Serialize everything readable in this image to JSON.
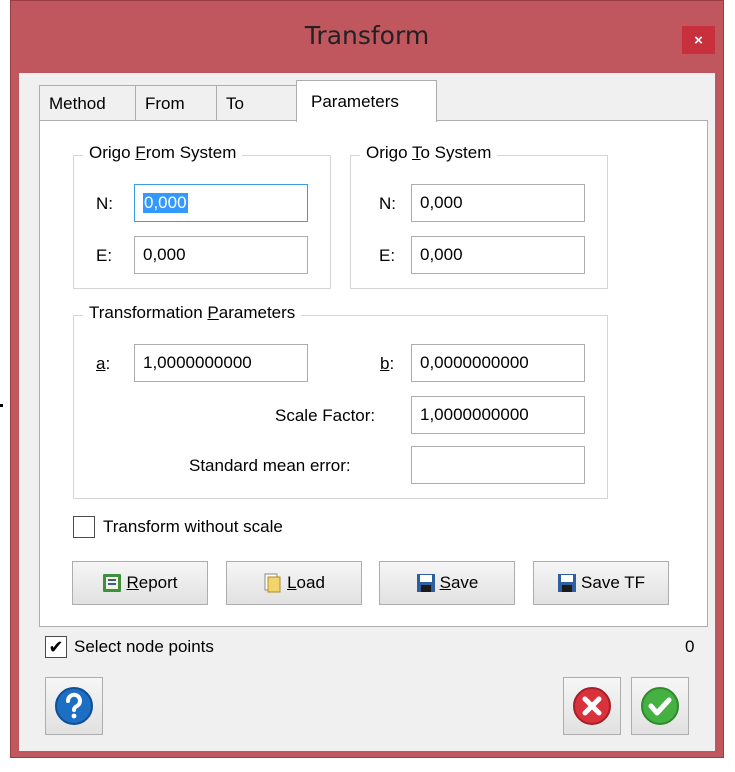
{
  "window": {
    "title": "Transform",
    "close_glyph": "×"
  },
  "tabs": [
    {
      "label": "Method",
      "active": false
    },
    {
      "label": "From",
      "active": false
    },
    {
      "label": "To",
      "active": false
    },
    {
      "label": "Parameters",
      "active": true
    }
  ],
  "origo_from": {
    "legend_pre": "Origo ",
    "legend_key": "F",
    "legend_post": "rom System",
    "n_label": "N:",
    "n_value": "0,000",
    "e_label": "E:",
    "e_value": "0,000"
  },
  "origo_to": {
    "legend_pre": "Origo ",
    "legend_key": "T",
    "legend_post": "o System",
    "n_label": "N:",
    "n_value": "0,000",
    "e_label": "E:",
    "e_value": "0,000"
  },
  "transformation_params": {
    "legend_pre": "Transformation ",
    "legend_key": "P",
    "legend_post": "arameters",
    "a_key": "a",
    "a_colon": ":",
    "a_value": "1,0000000000",
    "b_key": "b",
    "b_colon": ":",
    "b_value": "0,0000000000",
    "scale_label": "Scale Factor:",
    "scale_value": "1,0000000000",
    "sme_label": "Standard mean error:",
    "sme_value": ""
  },
  "transform_without_scale": {
    "label": "Transform without scale",
    "checked": false
  },
  "buttons": {
    "report": {
      "key": "R",
      "rest": "eport",
      "icon": "report-icon"
    },
    "load": {
      "key": "L",
      "rest": "oad",
      "icon": "folder-icon"
    },
    "save": {
      "key": "S",
      "rest": "ave",
      "icon": "floppy-icon"
    },
    "save_tf": {
      "label": "Save TF",
      "icon": "floppy-icon"
    }
  },
  "select_node_points": {
    "label": "Select node points",
    "checked": true,
    "checkmark": "✔"
  },
  "node_count": "0",
  "colors": {
    "title_bg": "#c0575f",
    "close_bg": "#c9303e",
    "focus_border": "#3c9be2",
    "help_blue": "#1d6fc4",
    "cancel_red": "#d9323c",
    "ok_green": "#45b142"
  }
}
